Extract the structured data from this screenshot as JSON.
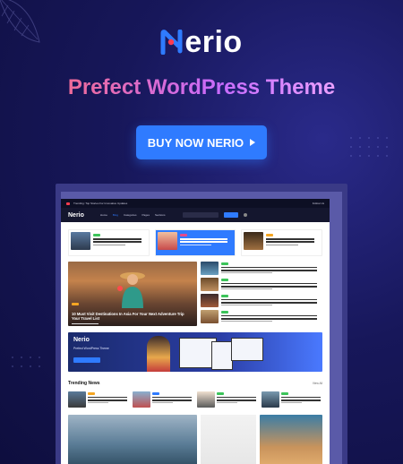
{
  "brand": {
    "logo_rest": "erio",
    "accent": "#2f7bff",
    "brand_red": "#ff3b4e"
  },
  "headline": "Prefect WordPress Theme",
  "cta": {
    "label": "BUY NOW NERIO",
    "icon": "play-triangle-icon"
  },
  "preview": {
    "topbar": {
      "left": "Trending: Top Stories For Innovative Updates",
      "right": "Follow Us"
    },
    "navbar": {
      "brand": "Nerio",
      "items": [
        "Home",
        "Blog",
        "Categories",
        "Pages",
        "Sections"
      ],
      "login": "Login"
    },
    "trending_title": "Trending News",
    "view_all": "View All",
    "hero_title": "10 Must Visit Destinations In Asia For Your Next Adventure Trip Your Travel List",
    "banner": {
      "brand": "Nerio",
      "subtitle": "Prefect WordPress Theme"
    },
    "colors": {
      "tag_green": "#3cc45a",
      "tag_orange": "#f5a623",
      "tag_blue": "#2f7bff",
      "tag_pink": "#e54a8a"
    }
  }
}
